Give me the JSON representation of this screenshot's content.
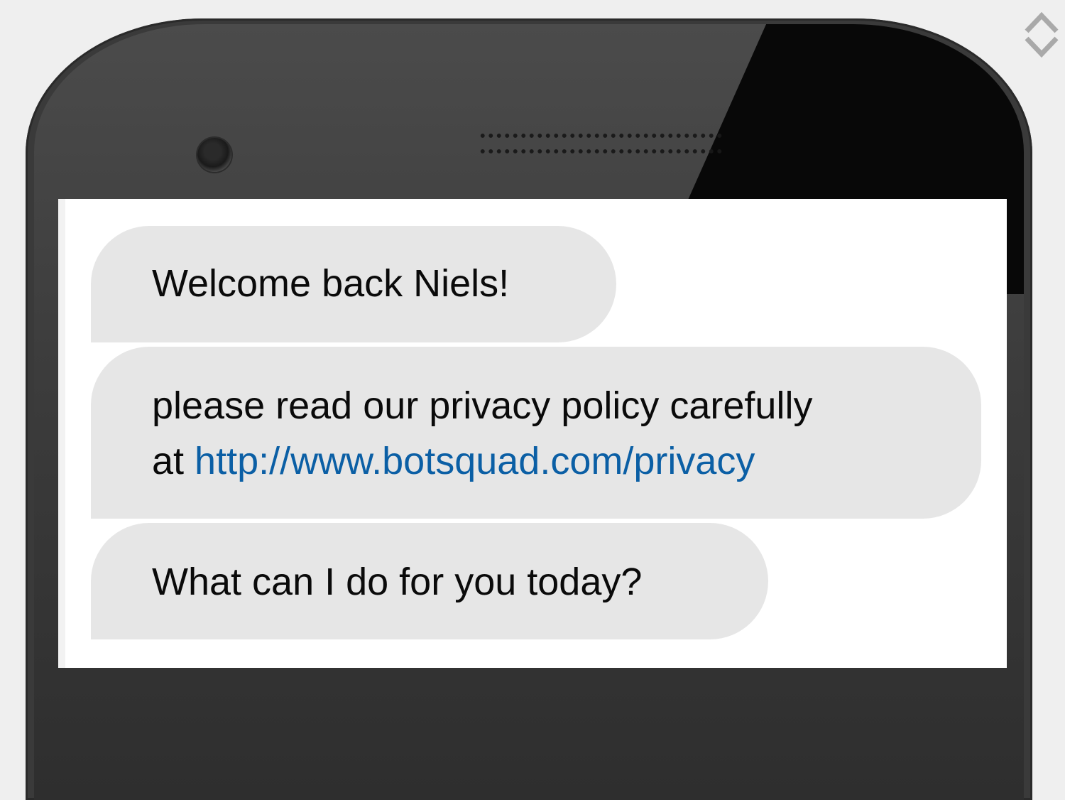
{
  "messages": [
    {
      "text": "Welcome back Niels!"
    },
    {
      "line1": "please read our privacy policy carefully",
      "line2_prefix": "at ",
      "link_text": "http://www.botsquad.com/privacy"
    },
    {
      "text": "What can I do for you today?"
    }
  ],
  "colors": {
    "bubble": "#e6e6e6",
    "link": "#0b5fa5",
    "background": "#efefef"
  },
  "icons": [
    "camera-icon",
    "speaker-grille",
    "scroll-chevrons-icon"
  ]
}
